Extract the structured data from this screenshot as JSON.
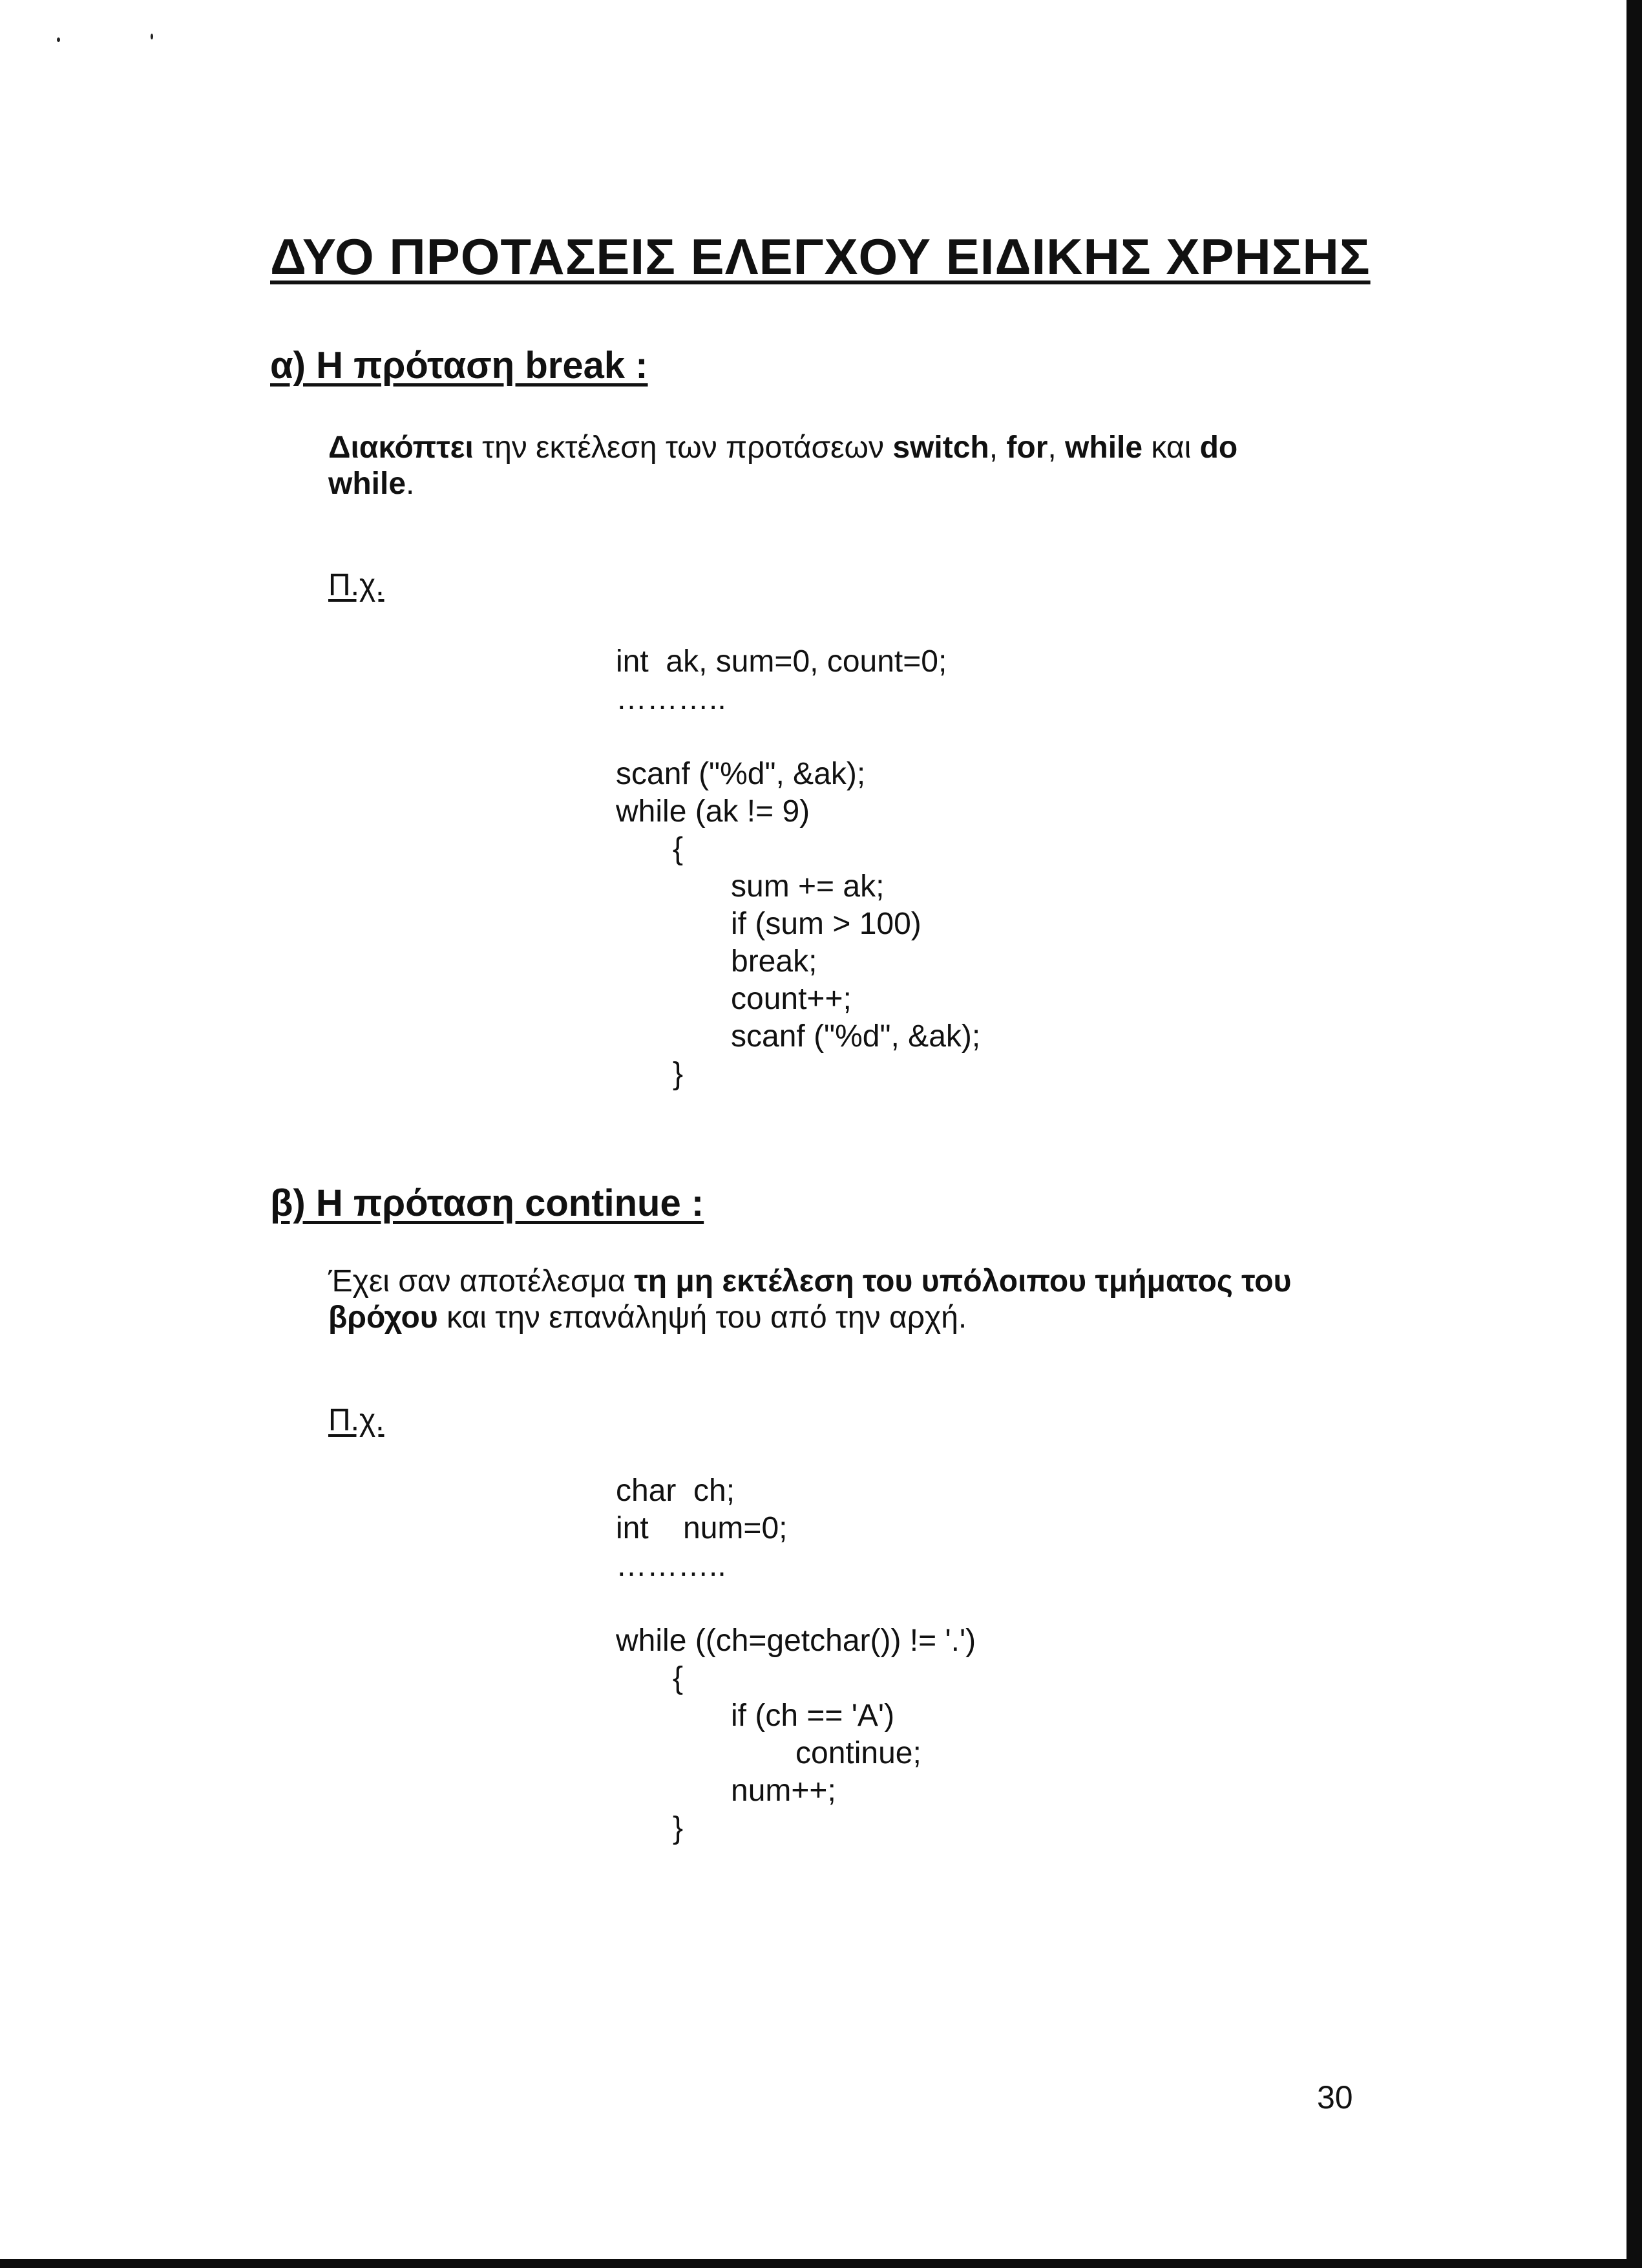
{
  "title": "ΔΥΟ ΠΡΟΤΑΣΕΙΣ ΕΛΕΓΧΟΥ ΕΙΔΙΚΗΣ ΧΡΗΣΗΣ",
  "section_a": {
    "heading": "α) Η πρόταση break :",
    "desc": {
      "t1": "Διακόπτει",
      "t2": " την εκτέλεση των προτάσεων ",
      "t3": "switch",
      "t4": ", ",
      "t5": "for",
      "t6": ", ",
      "t7": "while",
      "t8": " και ",
      "t9": "do",
      "t10": "while",
      "t11": "."
    },
    "example_label": "Π.χ.",
    "code": [
      "int  ak, sum=0, count=0;",
      "………..",
      "",
      "scanf (\"%d\", &ak);",
      "while (ak != 9)",
      "{",
      "sum += ak;",
      "if (sum > 100)",
      "break;",
      "count++;",
      "scanf (\"%d\", &ak);",
      "}"
    ]
  },
  "section_b": {
    "heading": "β) Η πρόταση continue :",
    "desc": {
      "t1": "Έχει σαν αποτέλεσμα ",
      "t2": "τη μη εκτέλεση του υπόλοιπου τμήματος του",
      "t3": "βρόχου",
      "t4": " και την επανάληψή του από την αρχή."
    },
    "example_label": "Π.χ.",
    "code": [
      "char  ch;",
      "int    num=0;",
      "………..",
      "",
      "while ((ch=getchar()) != '.')",
      "{",
      "if (ch == 'A')",
      "continue;",
      "num++;",
      "}"
    ]
  },
  "page_number": "30"
}
